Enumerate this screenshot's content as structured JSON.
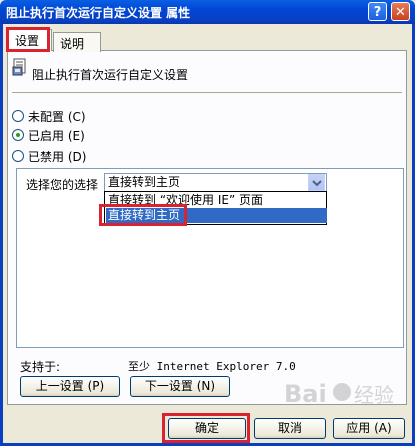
{
  "window": {
    "title": "阻止执行首次运行自定义设置 属性",
    "help_glyph": "?",
    "close_glyph": "✕"
  },
  "tabs": [
    {
      "label": "设置"
    },
    {
      "label": "说明"
    }
  ],
  "policy": {
    "title": "阻止执行首次运行自定义设置"
  },
  "radios": [
    {
      "label": "未配置 (C)",
      "checked": false
    },
    {
      "label": "已启用 (E)",
      "checked": true
    },
    {
      "label": "已禁用 (D)",
      "checked": false
    }
  ],
  "options": {
    "label": "选择您的选择",
    "selected": "直接转到主页",
    "dropdown": [
      "直接转到 “欢迎使用 IE” 页面",
      "直接转到主页"
    ]
  },
  "support": {
    "label": "支持于:",
    "value": "至少 Internet Explorer 7.0"
  },
  "nav": {
    "prev": "上一设置 (P)",
    "next": "下一设置 (N)"
  },
  "footer": {
    "ok": "确定",
    "cancel": "取消",
    "apply": "应用 (A)"
  },
  "watermark": {
    "text": "Baidu 经验"
  },
  "colors": {
    "titlebar": "#0a3fc2",
    "highlight": "#316ac5",
    "annotation_red": "#d9232e"
  }
}
